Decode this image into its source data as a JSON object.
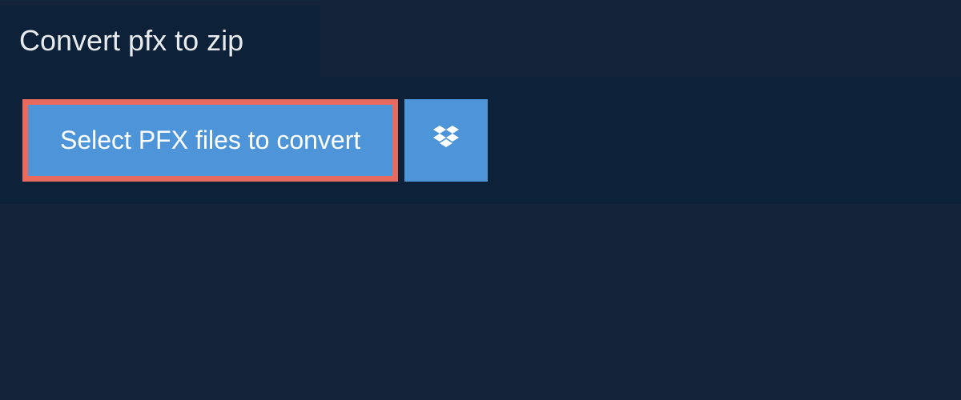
{
  "header": {
    "title": "Convert pfx to zip"
  },
  "actions": {
    "select_files_label": "Select PFX files to convert",
    "dropbox_icon": "dropbox-icon"
  },
  "colors": {
    "background": "#14223a",
    "panel": "#0d2138",
    "button": "#4d95d8",
    "highlight_border": "#e86a5f",
    "text_light": "#e8ebee"
  }
}
